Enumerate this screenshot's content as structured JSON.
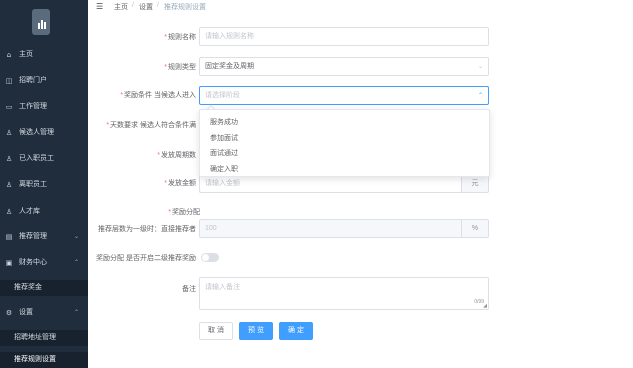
{
  "sidebar": {
    "items": [
      {
        "label": "主页",
        "icon": "home-icon"
      },
      {
        "label": "招聘门户",
        "icon": "portal-icon"
      },
      {
        "label": "工作管理",
        "icon": "briefcase-icon"
      },
      {
        "label": "候选人管理",
        "icon": "user-icon"
      },
      {
        "label": "已入职员工",
        "icon": "user-check-icon"
      },
      {
        "label": "离职员工",
        "icon": "user-exit-icon"
      },
      {
        "label": "人才库",
        "icon": "people-icon"
      },
      {
        "label": "推荐管理",
        "icon": "recommend-icon",
        "chevron": "⌄"
      },
      {
        "label": "财务中心",
        "icon": "finance-icon",
        "chevron": "⌃"
      },
      {
        "label": "推荐奖金",
        "sub": true
      },
      {
        "label": "设置",
        "icon": "settings-icon",
        "chevron": "⌃"
      },
      {
        "label": "招聘地址管理",
        "sub": true
      },
      {
        "label": "推荐规则设置",
        "sub": true
      }
    ]
  },
  "breadcrumb": {
    "home": "主页",
    "sep": "/",
    "settings": "设置",
    "current": "推荐规则设置"
  },
  "form": {
    "rule_name": {
      "label": "规则名称",
      "placeholder": "请输入规则名称"
    },
    "rule_type": {
      "label": "规则类型",
      "value": "固定奖金及周期"
    },
    "reward_condition": {
      "label": "奖励条件 当候选人进入",
      "placeholder": "请选择阶段"
    },
    "days_required": {
      "label": "天数要求 候选人符合条件满"
    },
    "payout_cycle": {
      "label": "发放周期数"
    },
    "payout_amount": {
      "label": "发放金额",
      "placeholder": "请输入金额",
      "unit": "元"
    },
    "reward_split": {
      "label": "奖励分配"
    },
    "level1_ratio": {
      "label": "推荐层数为一级时：直接推荐者",
      "value": "100",
      "unit": "%"
    },
    "level2_toggle": {
      "label": "奖励分配 是否开启二级推荐奖励"
    },
    "remark": {
      "label": "备注",
      "placeholder": "请输入备注",
      "counter": "0/99"
    }
  },
  "dropdown": {
    "options": [
      "服务成功",
      "参加面试",
      "面试通过",
      "确定入职"
    ]
  },
  "buttons": {
    "cancel": "取 消",
    "preview": "预 览",
    "confirm": "确 定"
  },
  "colors": {
    "sidebar_bg": "#1f2d3d",
    "primary": "#409eff",
    "required": "#f56c6c"
  }
}
